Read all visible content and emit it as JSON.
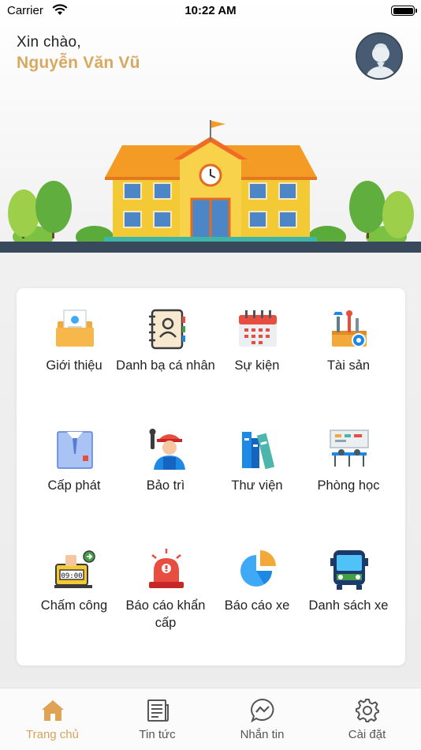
{
  "status_bar": {
    "carrier": "Carrier",
    "time": "10:22 AM"
  },
  "header": {
    "greeting": "Xin chào,",
    "user_name": "Nguyễn Văn Vũ",
    "avatar_icon": "user-avatar-icon"
  },
  "colors": {
    "accent": "#d7a85d",
    "active_tab": "#d7a35c",
    "inactive_tab": "#555555"
  },
  "menu": [
    {
      "label": "Giới thiệu",
      "icon": "folder-profile-icon"
    },
    {
      "label": "Danh bạ cá nhân",
      "icon": "contact-book-icon"
    },
    {
      "label": "Sự kiện",
      "icon": "calendar-icon"
    },
    {
      "label": "Tài sản",
      "icon": "toolbox-icon"
    },
    {
      "label": "Cấp phát",
      "icon": "shirt-icon"
    },
    {
      "label": "Bảo trì",
      "icon": "repairman-icon"
    },
    {
      "label": "Thư viện",
      "icon": "books-icon"
    },
    {
      "label": "Phòng học",
      "icon": "classroom-icon"
    },
    {
      "label": "Chấm công",
      "icon": "time-clock-icon"
    },
    {
      "label": "Báo cáo khẩn cấp",
      "icon": "emergency-siren-icon"
    },
    {
      "label": "Báo cáo xe",
      "icon": "pie-chart-icon"
    },
    {
      "label": "Danh sách xe",
      "icon": "bus-icon"
    }
  ],
  "clock_display": "09:00",
  "tabs": [
    {
      "label": "Trang chủ",
      "icon": "home-icon",
      "active": true
    },
    {
      "label": "Tin tức",
      "icon": "news-icon",
      "active": false
    },
    {
      "label": "Nhắn tin",
      "icon": "chat-icon",
      "active": false
    },
    {
      "label": "Cài đặt",
      "icon": "settings-gear-icon",
      "active": false
    }
  ]
}
